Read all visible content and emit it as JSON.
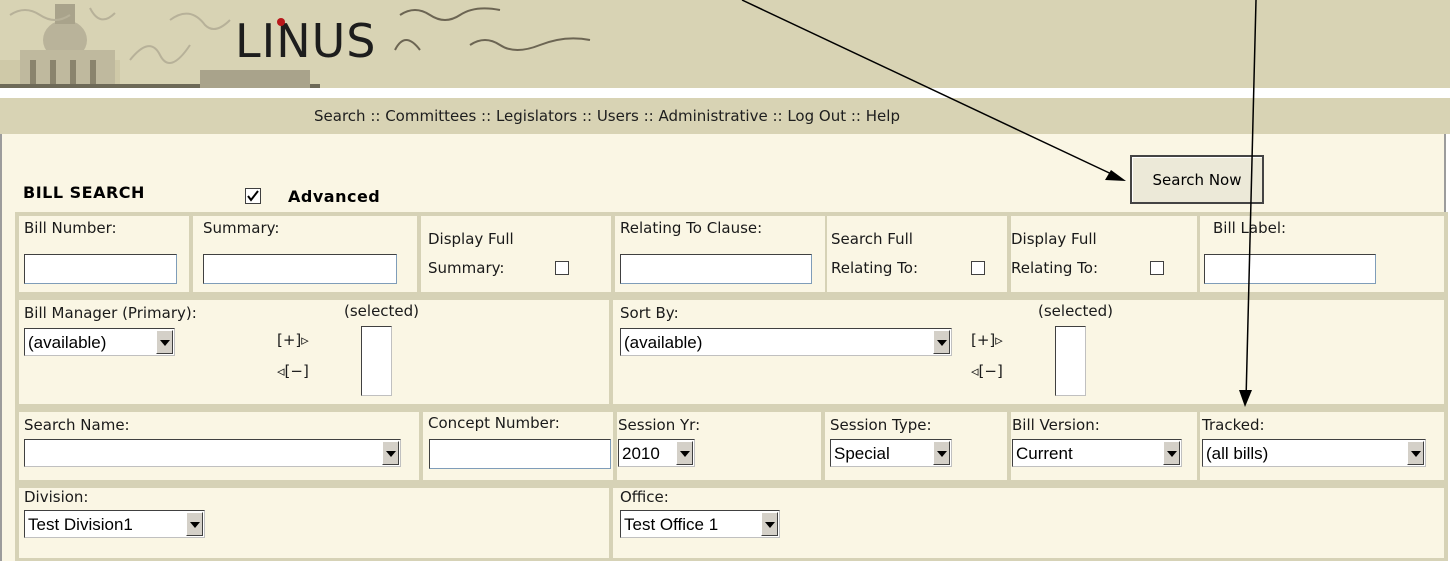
{
  "header": {
    "logo_text": "LINUS",
    "nav": [
      "Search",
      "Committees",
      "Legislators",
      "Users",
      "Administrative",
      "Log Out",
      "Help"
    ],
    "nav_separator": " :: "
  },
  "form": {
    "title": "BILL SEARCH",
    "advanced_label": "Advanced",
    "advanced_checked": true,
    "search_now_label": "Search Now",
    "row1": {
      "bill_number_label": "Bill Number:",
      "summary_label": "Summary:",
      "display_full_summary_line1": "Display Full",
      "display_full_summary_line2": "Summary:",
      "relating_to_clause_label": "Relating To Clause:",
      "search_full_relating_line1": "Search Full",
      "search_full_relating_line2": "Relating To:",
      "display_full_relating_line1": "Display Full",
      "display_full_relating_line2": "Relating To:",
      "bill_label_label": "Bill Label:"
    },
    "row2": {
      "bill_manager_label": "Bill Manager (Primary):",
      "bill_manager_value": "(available)",
      "add_label": "[+]▹",
      "remove_label": "◃[−]",
      "selected_label": "(selected)",
      "sort_by_label": "Sort By:",
      "sort_by_value": "(available)"
    },
    "row3": {
      "search_name_label": "Search Name:",
      "search_name_value": "",
      "concept_number_label": "Concept Number:",
      "session_yr_label": "Session Yr:",
      "session_yr_value": "2010",
      "session_type_label": "Session Type:",
      "session_type_value": "Special",
      "bill_version_label": "Bill Version:",
      "bill_version_value": "Current",
      "tracked_label": "Tracked:",
      "tracked_value": "(all bills)"
    },
    "row4": {
      "division_label": "Division:",
      "division_value": "Test Division1",
      "office_label": "Office:",
      "office_value": "Test Office 1"
    }
  }
}
